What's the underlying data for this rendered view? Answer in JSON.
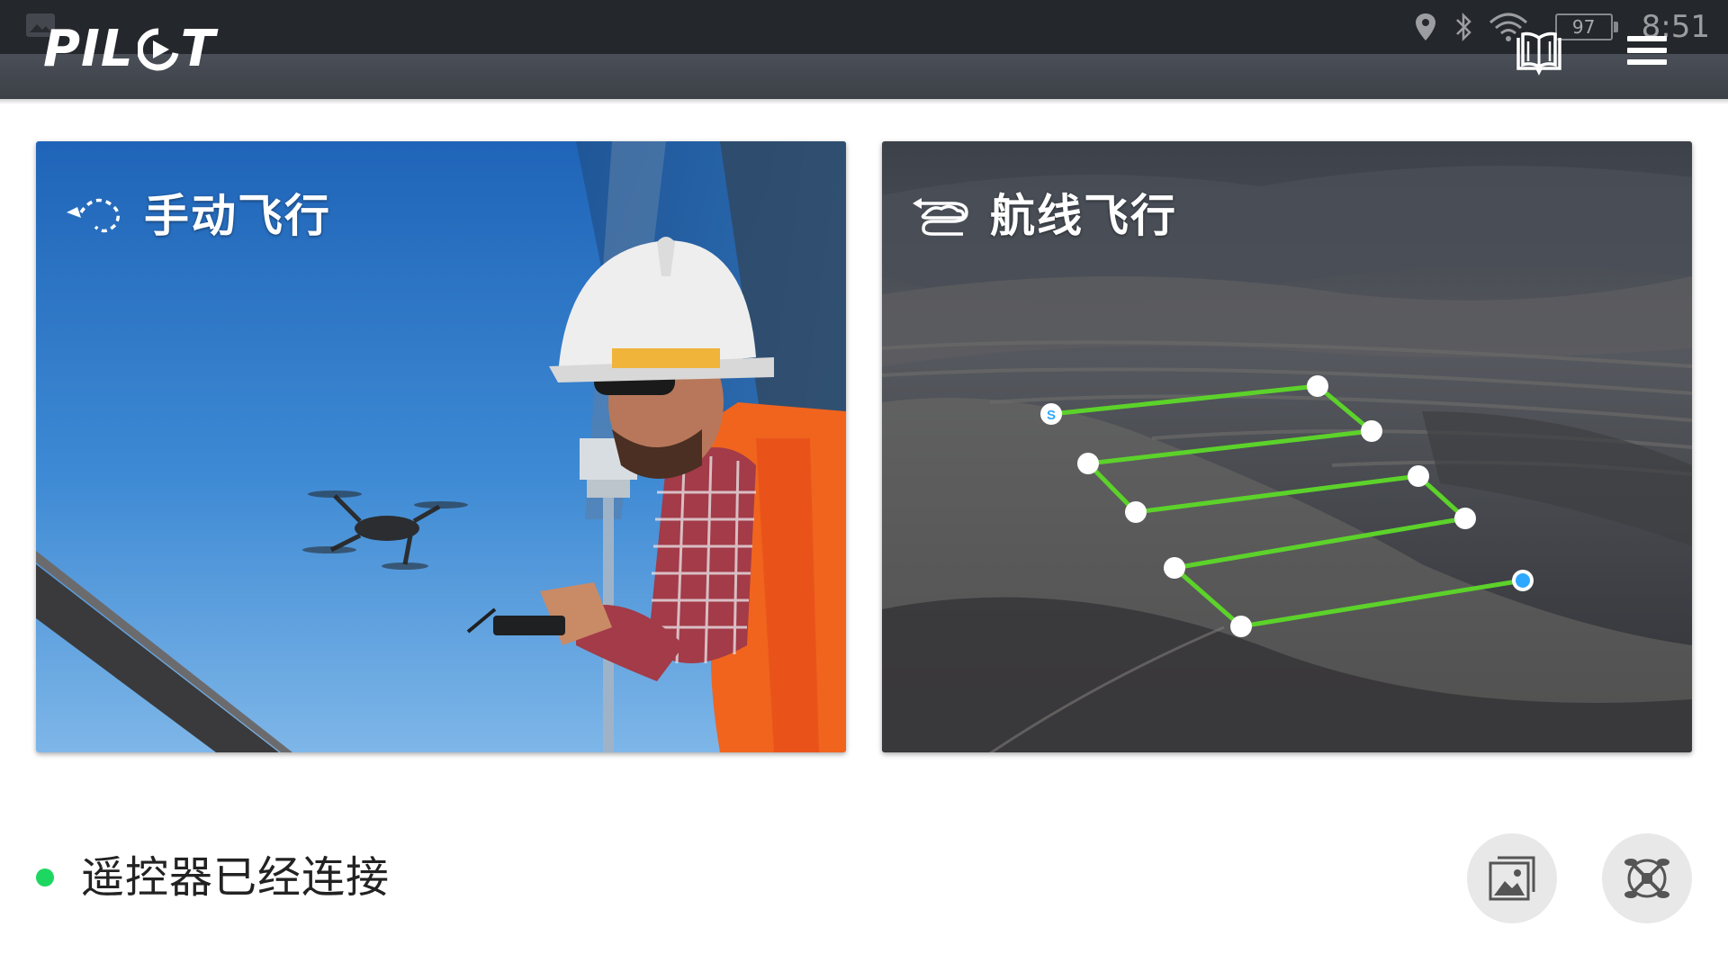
{
  "app": {
    "logo_text": "PIL",
    "logo_text_end": "T"
  },
  "status_bar": {
    "battery": "97",
    "time": "8:51",
    "icons": [
      "notification-image-icon",
      "location-icon",
      "bluetooth-icon",
      "wifi-icon",
      "battery-icon"
    ]
  },
  "header": {
    "buttons": [
      "manual-book-icon",
      "hamburger-menu-icon"
    ]
  },
  "cards": {
    "manual": {
      "title": "手动飞行",
      "icon": "manual-flight-path-icon"
    },
    "route": {
      "title": "航线飞行",
      "icon": "route-flight-icon",
      "start_marker": "S"
    }
  },
  "footer": {
    "status_text": "遥控器已经连接",
    "status_color": "#1ed760",
    "buttons": [
      "gallery-icon",
      "academy-drone-icon"
    ]
  },
  "colors": {
    "header": "#3c4047",
    "status_bar": "#24272c",
    "route_line": "#5cd22a",
    "end_waypoint": "#2ea8ff"
  }
}
